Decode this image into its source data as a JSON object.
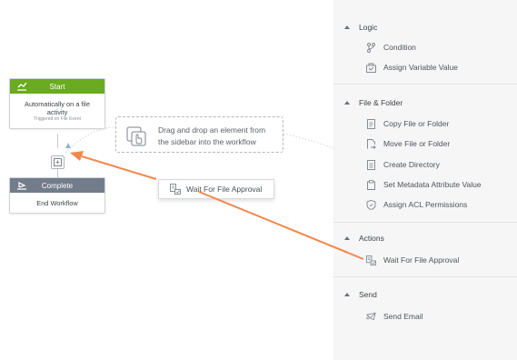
{
  "canvas": {
    "start_node": {
      "title": "Start",
      "body_line1": "Automatically on a file",
      "body_line2": "activity",
      "subtitle": "Triggered on File Event"
    },
    "complete_node": {
      "title": "Complete",
      "body": "End Workflow"
    },
    "dropzone": {
      "line1": "Drag and drop an element from",
      "line2": "the sidebar into the workflow"
    },
    "drag_card": {
      "label": "Wait For File Approval"
    }
  },
  "sidebar": {
    "sections": [
      {
        "title": "Logic",
        "items": [
          "Condition",
          "Assign Variable Value"
        ]
      },
      {
        "title": "File & Folder",
        "items": [
          "Copy File or Folder",
          "Move File or Folder",
          "Create Directory",
          "Set Metadata Attribute Value",
          "Assign ACL Permissions"
        ]
      },
      {
        "title": "Actions",
        "items": [
          "Wait For File Approval"
        ]
      },
      {
        "title": "Send",
        "items": [
          "Send Email"
        ]
      }
    ]
  },
  "colors": {
    "start_header": "#6aab1f",
    "complete_header": "#737c8b",
    "arrow": "#f2874e",
    "sidebar_bg": "#f6f6f7"
  },
  "icons": {
    "condition": "branch-icon",
    "assign_variable": "variable-icon",
    "copy": "document-icon",
    "move": "move-file-icon",
    "create_directory": "folder-doc-icon",
    "metadata": "tag-doc-icon",
    "acl": "shield-icon",
    "approval": "approval-icon",
    "email": "email-icon"
  }
}
